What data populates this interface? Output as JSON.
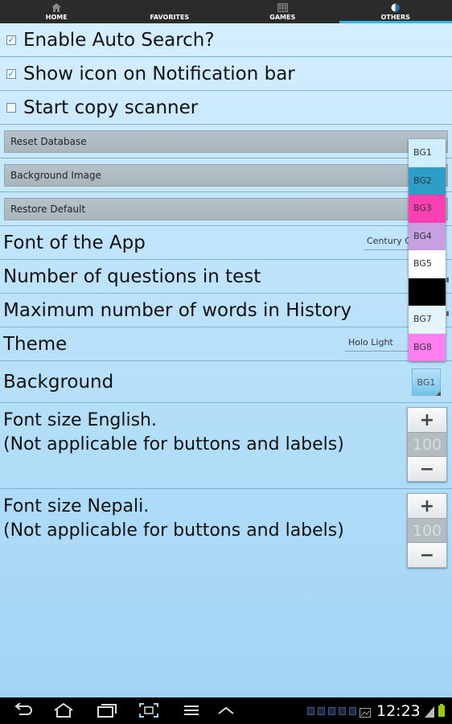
{
  "tabs": [
    {
      "label": "HOME",
      "icon": "home-icon"
    },
    {
      "label": "FAVORITES",
      "icon": "favorites-icon"
    },
    {
      "label": "GAMES",
      "icon": "games-icon"
    },
    {
      "label": "OTHERS",
      "icon": "others-icon",
      "active": true
    }
  ],
  "settings": {
    "auto_search": {
      "label": "Enable Auto Search?",
      "checked": true
    },
    "notification_icon": {
      "label": "Show icon on Notification bar",
      "checked": true
    },
    "copy_scanner": {
      "label": "Start copy scanner",
      "checked": false
    },
    "reset_database": "Reset Database",
    "background_image": "Background Image",
    "restore_default": "Restore Default",
    "font": {
      "label": "Font of the App",
      "value": "Century G"
    },
    "questions": {
      "label": "Number of questions in test"
    },
    "history": {
      "label": "Maximum number of words in History"
    },
    "theme": {
      "label": "Theme",
      "value": "Holo Light"
    },
    "background": {
      "label": "Background",
      "value": "BG1"
    },
    "font_size_english": {
      "line1": "Font size English.",
      "line2": "(Not applicable for buttons and labels)",
      "value": "100",
      "plus": "+",
      "minus": "−"
    },
    "font_size_nepali": {
      "line1": "Font size Nepali.",
      "line2": "(Not applicable for buttons and labels)",
      "value": "100",
      "plus": "+",
      "minus": "−"
    }
  },
  "bg_picker": {
    "options": [
      {
        "label": "BG1",
        "color": "#cfeeff"
      },
      {
        "label": "BG2",
        "color": "#2d9ec8"
      },
      {
        "label": "BG3",
        "color": "#ff3fb4"
      },
      {
        "label": "BG4",
        "color": "#c7a0e2"
      },
      {
        "label": "BG5",
        "color": "#ffffff"
      },
      {
        "label": "",
        "color": "#000000"
      },
      {
        "label": "BG7",
        "color": "#e4f4fb"
      },
      {
        "label": "BG8",
        "color": "#ff7ff0"
      }
    ]
  },
  "status": {
    "time": "12:23"
  },
  "colors": {
    "accent": "#33b5e5",
    "tabbar": "#2b2b2b"
  }
}
